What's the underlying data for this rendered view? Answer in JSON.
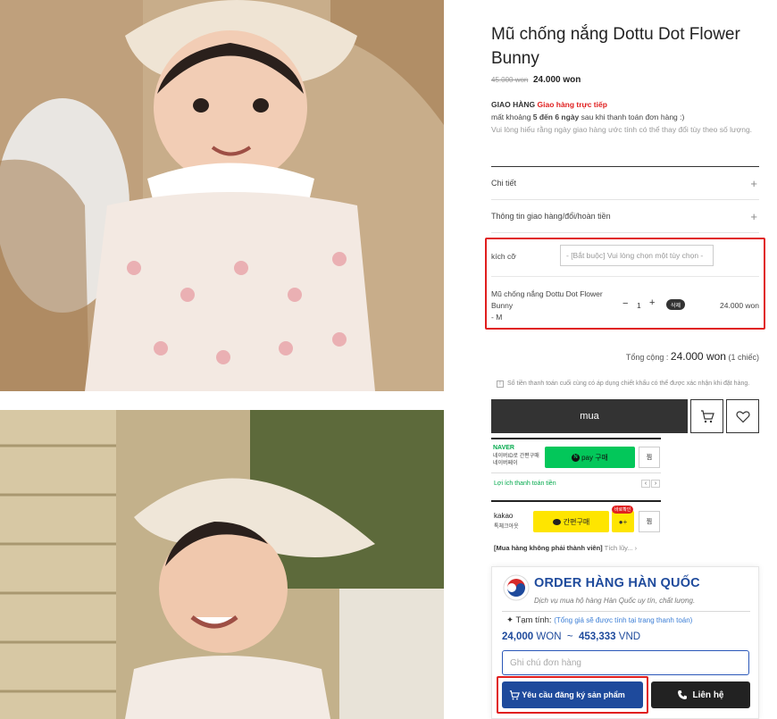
{
  "product": {
    "title": "Mũ chống nắng Dottu Dot Flower Bunny",
    "old_price": "45.000 won",
    "price": "24.000 won"
  },
  "shipping": {
    "label": "GIAO HÀNG",
    "method": "Giao hàng trực tiếp",
    "time_prefix": "mất khoảng ",
    "time_value": "5 đến 6 ngày",
    "time_suffix": " sau khi thanh toán đơn hàng :)",
    "note": "Vui lòng hiểu rằng ngày giao hàng ước tính có thể thay đổi tùy theo số lượng."
  },
  "accordion": [
    {
      "label": "Chi tiết",
      "icon": "plus-icon"
    },
    {
      "label": "Thông tin giao hàng/đổi/hoàn tiền",
      "icon": "plus-icon"
    }
  ],
  "options": {
    "size_label": "kích cỡ",
    "size_placeholder": "- [Bắt buộc] Vui lòng chọn một tùy chọn -",
    "selected_name": "Mũ chống nắng Dottu Dot Flower Bunny",
    "selected_variant": "- M",
    "qty_minus": "−",
    "qty": "1",
    "qty_plus": "+",
    "delete_label": "삭제",
    "selected_price": "24.000 won"
  },
  "total": {
    "label": "Tổng cộng :",
    "amount": "24.000 won",
    "count": "(1 chiếc)"
  },
  "notice": "Số tiền thanh toán cuối cùng có áp dụng chiết khấu có thể được xác nhận khi đặt hàng.",
  "actions": {
    "buy_label": "mua",
    "cart_icon": "cart-icon",
    "wishlist_icon": "heart-icon"
  },
  "naver": {
    "brand": "NAVER",
    "sub": "네이버ID로 간편구매 네이버페이",
    "pay_label": "pay 구매",
    "zzim_label": "찜",
    "benefit": "Lợi ích thanh toán tiền"
  },
  "kakao": {
    "brand": "kakao",
    "sub": "톡체크아웃",
    "buy_label": "간편구매",
    "badge": "바로확인",
    "zzim_label": "찜"
  },
  "member_note": {
    "bold": "[Mua hàng không phải thành viên]",
    "rest": "Tích lũy..."
  },
  "order_panel": {
    "title": "ORDER HÀNG HÀN QUỐC",
    "subtitle": "Dịch vụ mua hộ hàng Hàn Quốc uy tín, chất lượng.",
    "estimate_label": "Tạm tính:",
    "estimate_hint": "(Tổng giá sẽ được tính tại trang thanh toán)",
    "won_value": "24,000",
    "won_unit": "WON",
    "separator": "~",
    "vnd_value": "453,333",
    "vnd_unit": "VND",
    "note_placeholder": "Ghi chú đơn hàng",
    "request_label": "Yêu cầu đăng ký sản phẩm",
    "contact_label": "Liên hệ"
  },
  "colors": {
    "highlight_red": "#e01e1e",
    "brand_blue": "#1e4a9c",
    "naver_green": "#03c75a",
    "kakao_yellow": "#fee500"
  }
}
